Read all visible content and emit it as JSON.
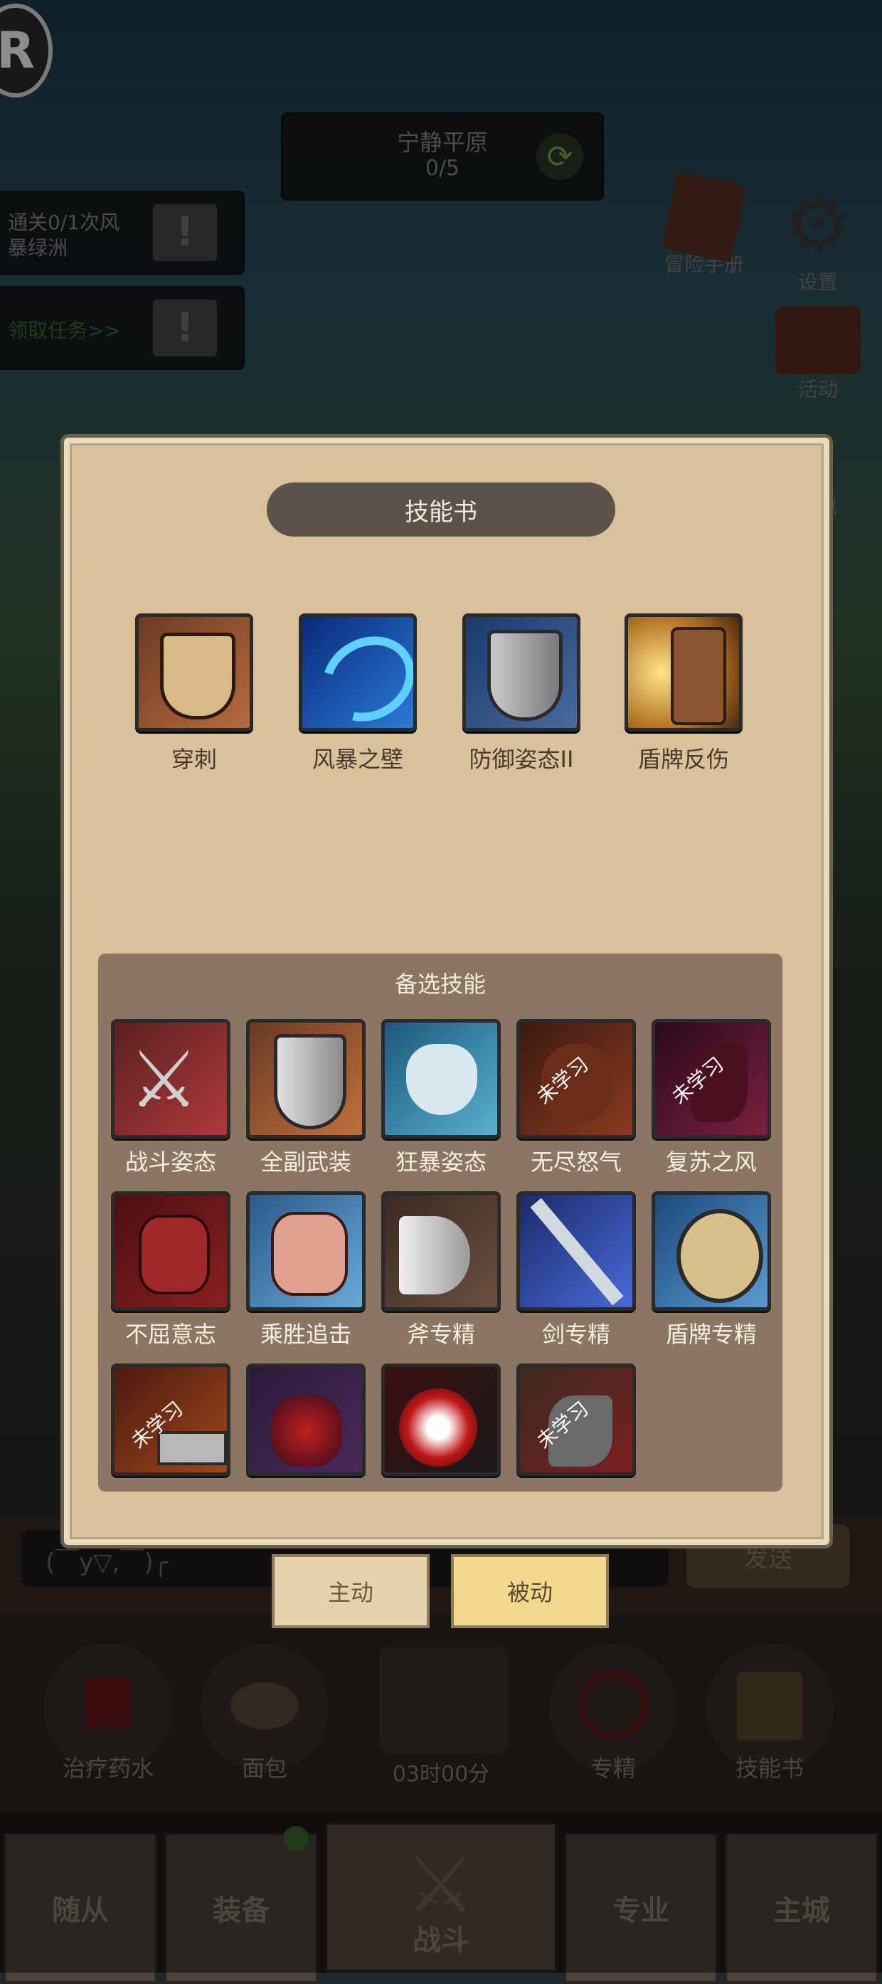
{
  "stage": {
    "name": "宁静平原",
    "progress": "0/5"
  },
  "quests": [
    {
      "text_line1": "通关0/1次风",
      "text_line2": "暴绿洲"
    },
    {
      "text_line1": "领取任务>>"
    }
  ],
  "right_menu": {
    "handbook": "冒险手册",
    "settings": "设置",
    "activity": "活动",
    "bag": "包"
  },
  "skill_book": {
    "title": "技能书",
    "equipped": [
      {
        "name": "穿刺",
        "icon": "shield-pierce-icon"
      },
      {
        "name": "风暴之壁",
        "icon": "storm-wall-icon"
      },
      {
        "name": "防御姿态II",
        "icon": "defense-stance-icon"
      },
      {
        "name": "盾牌反伤",
        "icon": "shield-reflect-icon"
      }
    ],
    "candidates_title": "备选技能",
    "candidates": [
      {
        "name": "战斗姿态",
        "icon": "crossed-swords-icon",
        "unlearned": ""
      },
      {
        "name": "全副武装",
        "icon": "shield-icon",
        "unlearned": ""
      },
      {
        "name": "狂暴姿态",
        "icon": "berserk-beast-icon",
        "unlearned": ""
      },
      {
        "name": "无尽怒气",
        "icon": "roaring-orc-icon",
        "unlearned": "未学习"
      },
      {
        "name": "复苏之风",
        "icon": "wind-cloak-icon",
        "unlearned": "未学习"
      },
      {
        "name": "不屈意志",
        "icon": "fist-icon",
        "unlearned": ""
      },
      {
        "name": "乘胜追击",
        "icon": "punch-icon",
        "unlearned": ""
      },
      {
        "name": "斧专精",
        "icon": "axe-icon",
        "unlearned": ""
      },
      {
        "name": "剑专精",
        "icon": "sword-icon",
        "unlearned": ""
      },
      {
        "name": "盾牌专精",
        "icon": "round-shield-icon",
        "unlearned": ""
      },
      {
        "name": "",
        "icon": "slash-icon",
        "unlearned": "未学习"
      },
      {
        "name": "",
        "icon": "flame-fist-icon",
        "unlearned": ""
      },
      {
        "name": "",
        "icon": "blood-strike-icon",
        "unlearned": ""
      },
      {
        "name": "",
        "icon": "claw-icon",
        "unlearned": "未学习"
      }
    ],
    "tabs": {
      "active": "主动",
      "passive": "被动"
    }
  },
  "chat": {
    "input_text": "(￣y▽,￣)╭",
    "send": "发送"
  },
  "quick_items": {
    "potion": "治疗药水",
    "bread": "面包",
    "timer": "03时00分",
    "specialize": "专精",
    "skillbook": "技能书"
  },
  "bottom_nav": {
    "followers": "随从",
    "equipment": "装备",
    "battle": "战斗",
    "profession": "专业",
    "city": "主城"
  },
  "colors": {
    "panel": "#d9c29b",
    "subpanel": "#8a7663",
    "passive_tab": "#f3d98d",
    "active_tab": "#e6d2aa"
  }
}
